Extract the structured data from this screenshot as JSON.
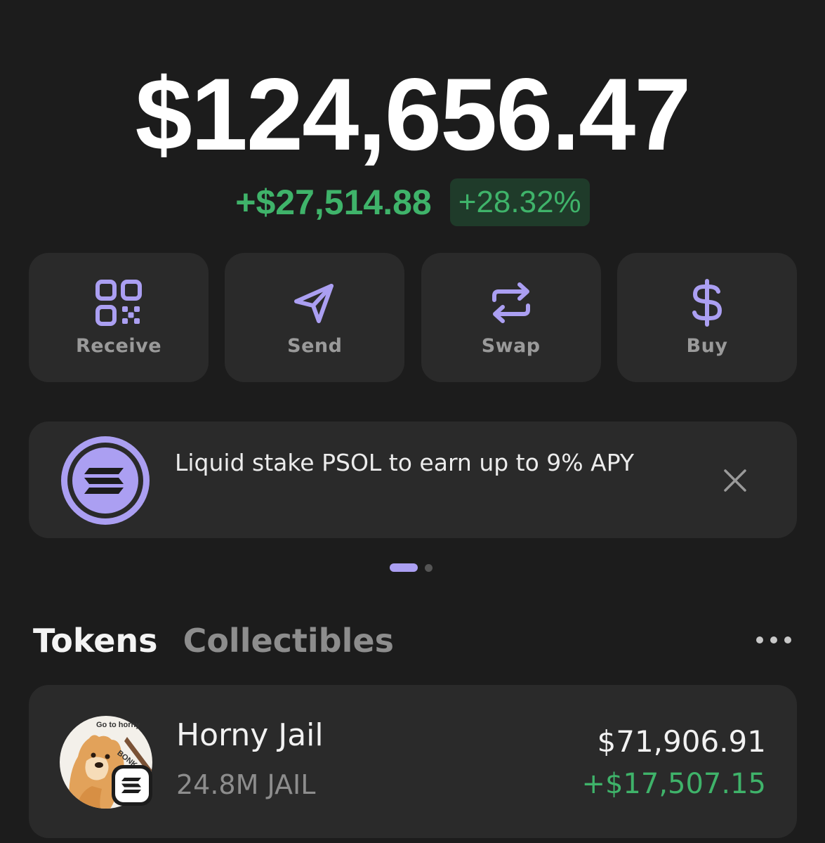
{
  "portfolio": {
    "balance": "$124,656.47",
    "change_amount": "+$27,514.88",
    "change_percent": "+28.32%"
  },
  "actions": [
    {
      "label": "Receive",
      "icon": "qr-code-icon"
    },
    {
      "label": "Send",
      "icon": "send-icon"
    },
    {
      "label": "Swap",
      "icon": "swap-icon"
    },
    {
      "label": "Buy",
      "icon": "dollar-icon"
    }
  ],
  "promo": {
    "text": "Liquid stake PSOL to earn up to 9% APY",
    "icon": "solana-logo-icon",
    "close_icon": "close-icon"
  },
  "carousel": {
    "active_index": 0,
    "count": 2
  },
  "tabs": [
    {
      "label": "Tokens",
      "active": true
    },
    {
      "label": "Collectibles",
      "active": false
    }
  ],
  "more_icon": "more-horizontal-icon",
  "tokens": [
    {
      "name": "Horny Jail",
      "quantity": "24.8M JAIL",
      "value": "$71,906.91",
      "change": "+$17,507.15",
      "image_caption": "Go to horny",
      "image_stamp": "BONK"
    }
  ],
  "colors": {
    "background": "#1c1c1c",
    "card": "#2a2a2a",
    "accent_purple": "#ab9ff2",
    "positive_green": "#3fb36a",
    "positive_bg": "#1f3b2a",
    "muted_text": "#8d8d8d"
  }
}
